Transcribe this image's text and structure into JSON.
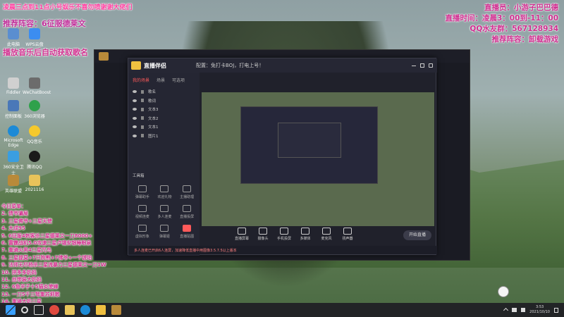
{
  "overlay": {
    "top_banner": "凌晨三点到11点小号娱乐不喜勿喷谢谢大佬们",
    "recommend": "推荐阵容：6征服德莱文",
    "auto_song": "播放音乐后自动获取歌名",
    "right_lines": [
      "直播员：小游子巴巴德",
      "直播时间：凌晨3：00到-11：00",
      "QQ水友群：567128934",
      "推荐阵容：卸载游戏"
    ]
  },
  "song_menu": {
    "title": "今日菜单：",
    "items": [
      "2. 倩爷骗局",
      "3. 三星佛爷+三星天使",
      "4. 大成95",
      "5. 6征服4刺客杀三星德莱文一刀8000+",
      "6. 雷霆战机5.0攻速三星卢锡安银睡眼泉",
      "7. 重骑火男4三星咒鸟",
      "8. 三星提莫+7只狗熊+7佛爷+一个琥珀",
      "9. 法师无尽杨杀三星流暴力三星德莱文一刀1W",
      "10. 拼多多奶妈",
      "11. 丝带装大奶妈",
      "12. 6鱼羊子十5猫炎使嫁",
      "13. 一刀5千三弩重苏莉歌",
      "14. 重骑大奶三星"
    ]
  },
  "desktop_icons": [
    "此电脑",
    "WPS云盘",
    "Fiddler",
    "WeChatBoost",
    "控制面板",
    "360浏览器",
    "Microsoft Edge",
    "QQ音乐",
    "360安全卫士",
    "腾讯QQ",
    "英雄联盟",
    "2021116"
  ],
  "app": {
    "brand": "直播伴侣",
    "header_tail": "配置：免打卡BOJ，打电上号！",
    "side_tabs": [
      "我的场景",
      "场景",
      "可选项"
    ],
    "layers": [
      "歌名",
      "歌词",
      "文本3",
      "文本2",
      "文本1",
      "图片1"
    ],
    "tools_title": "工具箱",
    "tools": [
      "弹幕助手",
      "欢迎礼物",
      "主播助理",
      "视频连麦",
      "多人连麦",
      "直播投屏",
      "虚拟形象",
      "弹幕姬",
      "直播贴图"
    ],
    "bottom_buttons": [
      "直播屏幕",
      "摄像头",
      "手机投屏",
      "多媒体",
      "麦克风",
      "扬声器"
    ],
    "start_button": "开始直播",
    "status_text": "多人连麦已开启6人连屏，加速降低直播中用图像3.5.7.5以上版本"
  },
  "taskbar": {
    "time": "3:53",
    "date": "2021/10/10"
  }
}
